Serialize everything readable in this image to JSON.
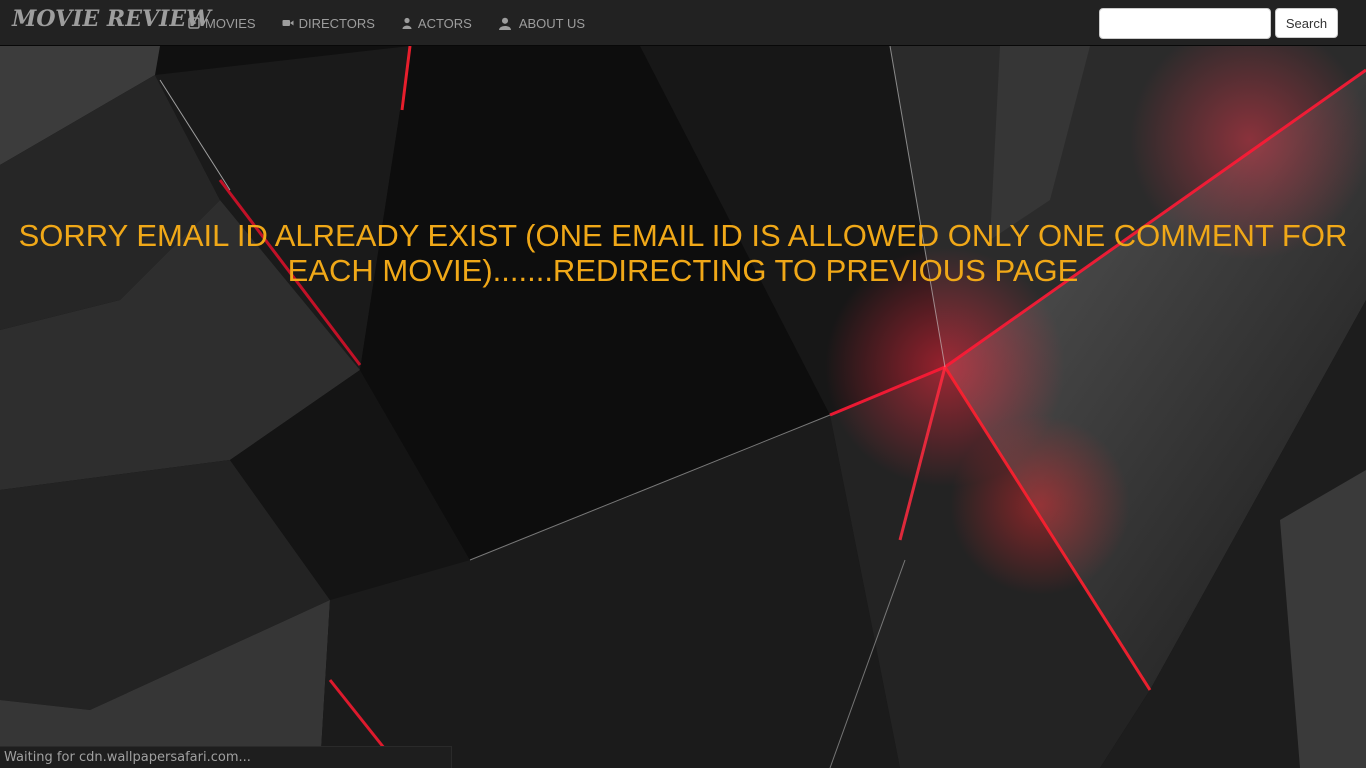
{
  "navbar": {
    "brand": "MOVIE REVIEW",
    "items": [
      {
        "label": "MOVIES",
        "icon": "film-icon"
      },
      {
        "label": "DIRECTORS",
        "icon": "video-camera-icon"
      },
      {
        "label": "ACTORS",
        "icon": "user-icon"
      },
      {
        "label": "ABOUT US",
        "icon": "user-icon"
      }
    ],
    "search": {
      "value": "",
      "placeholder": "",
      "button_label": "Search"
    }
  },
  "main": {
    "message": "SORRY EMAIL ID ALREADY EXIST (ONE EMAIL ID IS ALLOWED ONLY ONE COMMENT FOR EACH MOVIE).......REDIRECTING TO PREVIOUS PAGE"
  },
  "status_bar": {
    "text": "Waiting for cdn.wallpapersafari.com..."
  },
  "colors": {
    "navbar_bg": "#222222",
    "nav_text": "#9d9d9d",
    "message_text": "#f0a818",
    "accent_red": "#ff1030"
  }
}
